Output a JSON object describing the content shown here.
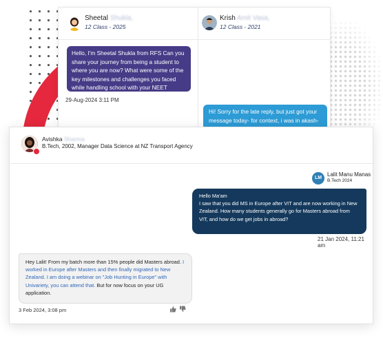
{
  "back_chat": {
    "left_user": {
      "first_name": "Sheetal",
      "last_name_blurred": "Shukla,",
      "class": "12 Class - 2025"
    },
    "right_user": {
      "first_name": "Krish",
      "last_name_blurred": "Amit Vasa,",
      "class": "12 Class - 2021"
    },
    "question": "Hello, I'm Sheetal Shukla from RFS Can you share your journey from being a student to where you are now? What were some of the key milestones and challenges you faced while handling school with your NEET studies..",
    "question_time": "29-Aug-2024 3:11 PM",
    "reply": "Hi! Sorry for the late reply, but just got your message today- for context, i was in akash-"
  },
  "front_chat": {
    "header": {
      "first_name": "Avishka",
      "last_name_blurred": "Sharma",
      "subtitle": "B.Tech, 2002, Manager Data Science at NZ Transport Agency"
    },
    "sender": {
      "initials": "LM",
      "name": "Lalit Manu Manas",
      "sub": "B.Tech 2024"
    },
    "question_lines": [
      "Hello Ma'am",
      "I saw that you did MS in Europe after VIT and are now working in New Zealand. How many students generally go for Masters abroad from VIT, and how do we get jobs in abroad?"
    ],
    "question_time": "21 Jan 2024, 11:21 am",
    "answer_part1": "Hey Lalit! From my batch more than 15% people did Masters abroad. ",
    "answer_highlight": "I worked in Europe after Masters and then finally migrated to New Zealand. I am doing a webinar on \"Job Hunting in Europe\" with Univariety, you can attend that.",
    "answer_part2": " But for now focus on your UG application.",
    "answer_time": "3 Feb 2024, 3:08 pm"
  },
  "icons": {
    "like": "thumbs-up-icon",
    "dislike": "thumbs-down-icon"
  },
  "colors": {
    "accent_red": "#e5283d",
    "purple": "#463b87",
    "blue": "#2d9bd5",
    "navy": "#14395c"
  }
}
